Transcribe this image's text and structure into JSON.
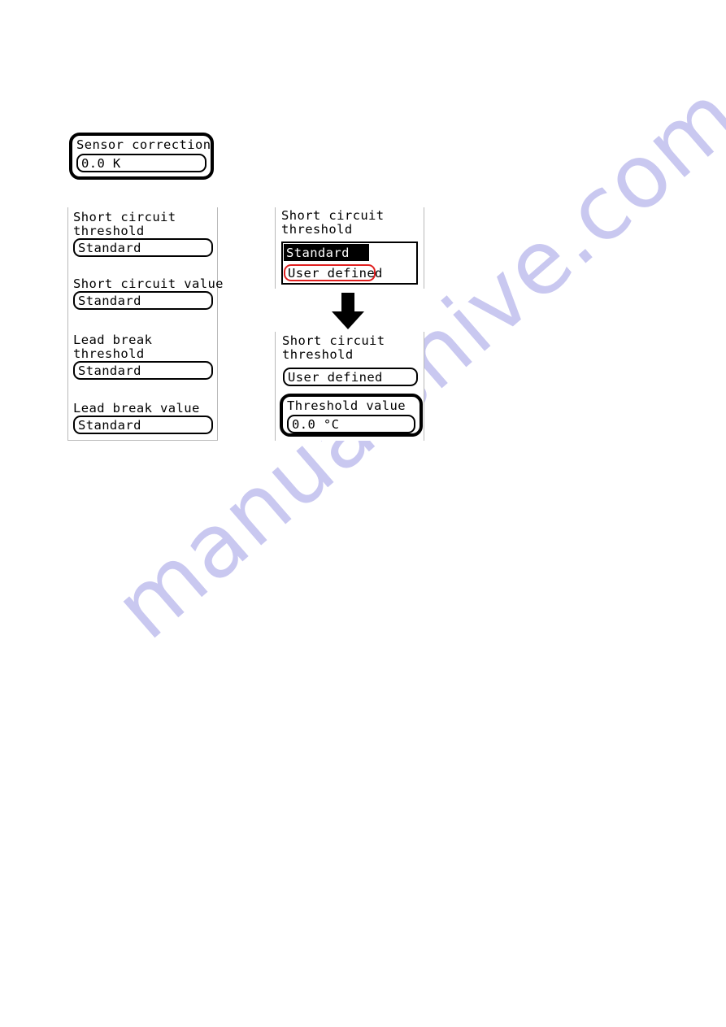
{
  "page": {
    "background_color": "#ffffff",
    "ink_color": "#000000",
    "panel_border_color": "#b9b9b9",
    "highlight_color": "#e02020"
  },
  "watermark": {
    "text": "manualshive.com",
    "color": "#c9c8f0"
  },
  "sensor_correction_panel": {
    "label": "Sensor correction",
    "value": "0.0 K"
  },
  "left_panel": {
    "rows": [
      {
        "label": "Short circuit\nthreshold",
        "value": "Standard"
      },
      {
        "label": "Short circuit value",
        "value": "Standard"
      },
      {
        "label": "Lead break\nthreshold",
        "value": "Standard"
      },
      {
        "label": "Lead break value",
        "value": "Standard"
      }
    ]
  },
  "right_top_panel": {
    "label": "Short circuit\nthreshold",
    "options": [
      {
        "text": "Standard",
        "state": "selected"
      },
      {
        "text": "User defined",
        "state": "highlighted"
      }
    ]
  },
  "flow_arrow": {
    "icon": "arrow-down-icon",
    "color": "#000000"
  },
  "right_bottom_panel": {
    "label": "Short circuit\nthreshold",
    "selection": "User defined",
    "threshold_label": "Threshold value",
    "threshold_value": "0.0 °C"
  }
}
